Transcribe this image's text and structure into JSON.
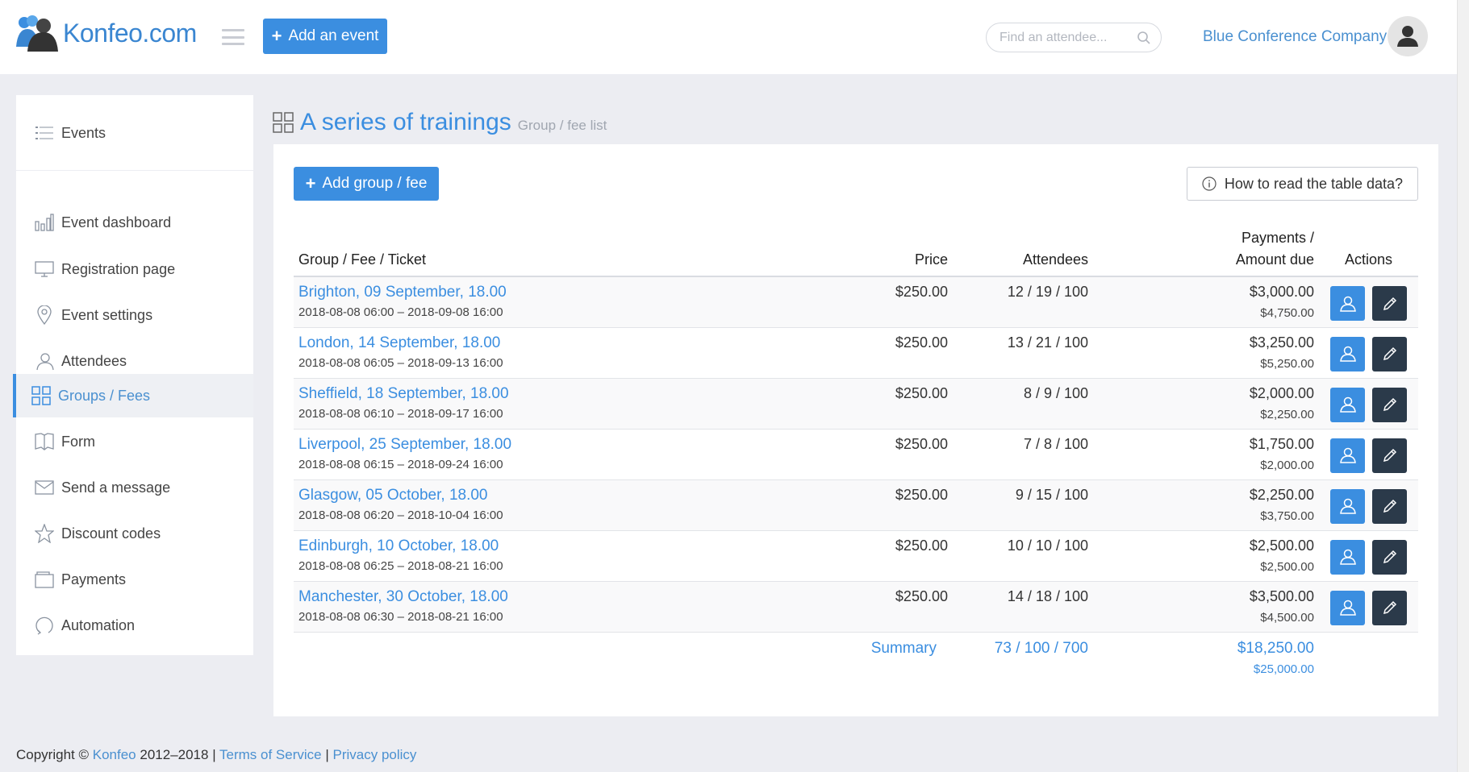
{
  "header": {
    "logo_text": "Konfeo.com",
    "add_event_label": "Add an event",
    "search_placeholder": "Find an attendee...",
    "company_name": "Blue Conference Company"
  },
  "sidebar": {
    "top": {
      "label": "Events",
      "icon": "list-icon"
    },
    "items": [
      {
        "label": "Event dashboard",
        "icon": "bar-chart-icon",
        "active": false
      },
      {
        "label": "Registration page",
        "icon": "monitor-icon",
        "active": false
      },
      {
        "label": "Event settings",
        "icon": "location-pin-icon",
        "active": false
      },
      {
        "label": "Attendees",
        "icon": "user-icon",
        "active": false
      },
      {
        "label": "Groups / Fees",
        "icon": "grid-icon",
        "active": true
      },
      {
        "label": "Form",
        "icon": "book-icon",
        "active": false
      },
      {
        "label": "Send a message",
        "icon": "envelope-icon",
        "active": false
      },
      {
        "label": "Discount codes",
        "icon": "star-icon",
        "active": false
      },
      {
        "label": "Payments",
        "icon": "wallet-icon",
        "active": false
      },
      {
        "label": "Automation",
        "icon": "refresh-icon",
        "active": false
      }
    ]
  },
  "page": {
    "title": "A series of trainings",
    "subtitle": "Group / fee list",
    "add_group_label": "Add group / fee",
    "howto_label": "How to read the table data?"
  },
  "table": {
    "headers": {
      "group": "Group / Fee / Ticket",
      "price": "Price",
      "attendees": "Attendees",
      "payments_line1": "Payments /",
      "payments_line2": "Amount due",
      "actions": "Actions"
    },
    "rows": [
      {
        "name": "Brighton, 09 September, 18.00",
        "dates": "2018-08-08 06:00 – 2018-09-08 16:00",
        "price": "$250.00",
        "attendees": "12 / 19 / 100",
        "payment": "$3,000.00",
        "due": "$4,750.00"
      },
      {
        "name": "London, 14 September, 18.00",
        "dates": "2018-08-08 06:05 – 2018-09-13 16:00",
        "price": "$250.00",
        "attendees": "13 / 21 / 100",
        "payment": "$3,250.00",
        "due": "$5,250.00"
      },
      {
        "name": "Sheffield, 18 September, 18.00",
        "dates": "2018-08-08 06:10 – 2018-09-17 16:00",
        "price": "$250.00",
        "attendees": "8 / 9 / 100",
        "payment": "$2,000.00",
        "due": "$2,250.00"
      },
      {
        "name": "Liverpool, 25 September, 18.00",
        "dates": "2018-08-08 06:15 – 2018-09-24 16:00",
        "price": "$250.00",
        "attendees": "7 / 8 / 100",
        "payment": "$1,750.00",
        "due": "$2,000.00"
      },
      {
        "name": "Glasgow, 05 October, 18.00",
        "dates": "2018-08-08 06:20 – 2018-10-04 16:00",
        "price": "$250.00",
        "attendees": "9 / 15 / 100",
        "payment": "$2,250.00",
        "due": "$3,750.00"
      },
      {
        "name": "Edinburgh, 10 October, 18.00",
        "dates": "2018-08-08 06:25 – 2018-08-21 16:00",
        "price": "$250.00",
        "attendees": "10 / 10 / 100",
        "payment": "$2,500.00",
        "due": "$2,500.00"
      },
      {
        "name": "Manchester, 30 October, 18.00",
        "dates": "2018-08-08 06:30 – 2018-08-21 16:00",
        "price": "$250.00",
        "attendees": "14 / 18 / 100",
        "payment": "$3,500.00",
        "due": "$4,500.00"
      }
    ],
    "summary": {
      "label": "Summary",
      "attendees": "73 / 100 / 700",
      "payment": "$18,250.00",
      "due": "$25,000.00"
    }
  },
  "footer": {
    "copyright_prefix": "Copyright ©",
    "brand": "Konfeo",
    "years": "2012–2018 |",
    "terms": "Terms of Service",
    "separator": "|",
    "privacy": "Privacy policy"
  },
  "colors": {
    "primary": "#3b8ee0",
    "dark_button": "#2b3a4a",
    "background": "#ecedf2"
  }
}
